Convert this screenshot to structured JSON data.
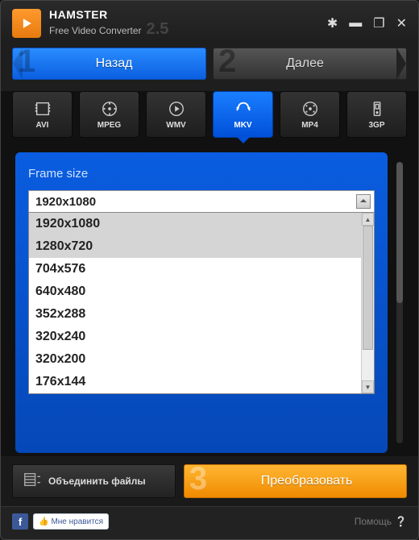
{
  "app": {
    "name": "HAMSTER",
    "subtitle": "Free Video Converter",
    "version": "2.5"
  },
  "nav": {
    "back": {
      "num": "1",
      "label": "Назад"
    },
    "next": {
      "num": "2",
      "label": "Далее"
    }
  },
  "formats": [
    {
      "id": "avi",
      "label": "AVI"
    },
    {
      "id": "mpeg",
      "label": "MPEG"
    },
    {
      "id": "wmv",
      "label": "WMV"
    },
    {
      "id": "mkv",
      "label": "MKV",
      "active": true
    },
    {
      "id": "mp4",
      "label": "MP4"
    },
    {
      "id": "3gp",
      "label": "3GP"
    }
  ],
  "panel": {
    "title": "Frame size",
    "selected": "1920x1080",
    "options": [
      "1920x1080",
      "1280x720",
      "704x576",
      "640x480",
      "352x288",
      "320x240",
      "320x200",
      "176x144"
    ],
    "highlighted": [
      "1920x1080",
      "1280x720"
    ]
  },
  "actions": {
    "merge": "Объединить файлы",
    "convert_num": "3",
    "convert": "Преобразовать"
  },
  "footer": {
    "fb": "f",
    "like": "Мне нравится",
    "help": "Помощь"
  }
}
